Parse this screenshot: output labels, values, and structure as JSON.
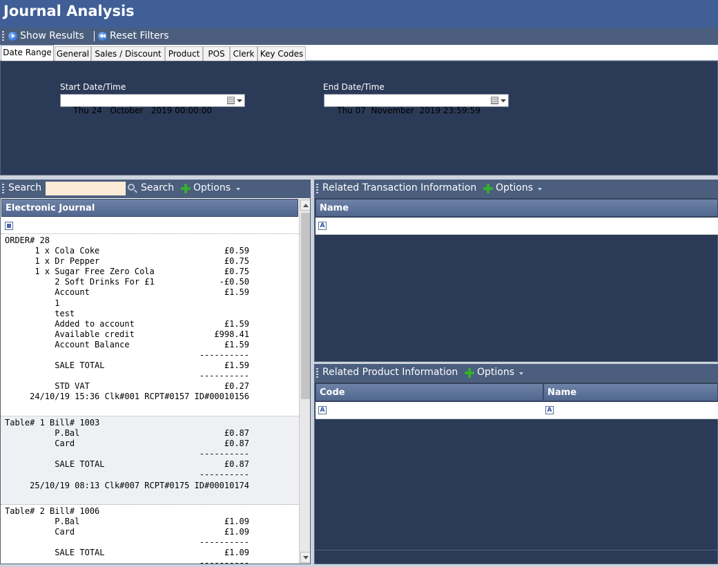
{
  "app": {
    "title": "Journal Analysis"
  },
  "toolbar": {
    "show_results": "Show Results",
    "reset_filters": "Reset Filters"
  },
  "tabs": [
    {
      "label": "Date Range",
      "active": true
    },
    {
      "label": "General"
    },
    {
      "label": "Sales  / Discount"
    },
    {
      "label": "Product"
    },
    {
      "label": "POS"
    },
    {
      "label": "Clerk"
    },
    {
      "label": "Key Codes"
    }
  ],
  "date_range": {
    "start_label": "Start Date/Time",
    "start_value": "Thu 24   October   2019 00:00:00",
    "end_label": "End Date/Time",
    "end_value": "Thu 07  November  2019 23:59:59"
  },
  "search_panel": {
    "label": "Search",
    "input_value": "",
    "search_button": "Search",
    "options": "Options"
  },
  "journal": {
    "column": "Electronic Journal",
    "receipts": [
      "ORDER# 28\n      1 x Cola Coke                         £0.59\n      1 x Dr Pepper                         £0.75\n      1 x Sugar Free Zero Cola              £0.75\n          2 Soft Drinks For £1             -£0.50\n          Account                           £1.59\n          1\n          test\n          Added to account                  £1.59\n          Available credit                £998.41\n          Account Balance                   £1.59\n                                       ----------\n          SALE TOTAL                        £1.59\n                                       ----------\n          STD VAT                           £0.27\n     24/10/19 15:36 Clk#001 RCPT#0157 ID#00010156",
      "Table# 1 Bill# 1003\n          P.Bal                             £0.87\n          Card                              £0.87\n                                       ----------\n          SALE TOTAL                        £0.87\n                                       ----------\n     25/10/19 08:13 Clk#007 RCPT#0175 ID#00010174",
      "Table# 2 Bill# 1006\n          P.Bal                             £1.09\n          Card                              £1.09\n                                       ----------\n          SALE TOTAL                        £1.09\n                                       ----------"
    ]
  },
  "related_transaction": {
    "label": "Related Transaction Information",
    "options": "Options",
    "columns": [
      "Name"
    ]
  },
  "related_product": {
    "label": "Related Product Information",
    "options": "Options",
    "columns": [
      "Code",
      "Name"
    ]
  },
  "icons": {
    "show_results": "play-icon",
    "reset_filters": "rewind-icon",
    "options": "plus-icon",
    "search": "search-icon"
  },
  "colors": {
    "title_bar": "#3f5f96",
    "toolbar": "#4b5e7e",
    "panel": "#2b3a56",
    "search_input": "#faebd7"
  }
}
